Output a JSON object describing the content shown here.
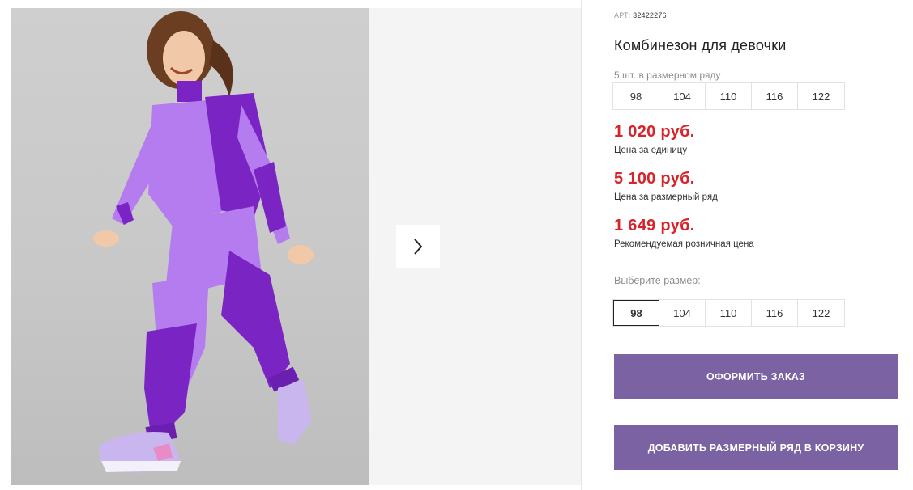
{
  "gallery": {
    "photo_alt": "",
    "next_icon": "chevron-right-icon"
  },
  "product": {
    "art_label": "АРТ:",
    "art_number": "32422276",
    "title": "Комбинезон для девочки",
    "pack_note": "5 шт. в размерном ряду",
    "pack_sizes": [
      "98",
      "104",
      "110",
      "116",
      "122"
    ],
    "prices": [
      {
        "value": "1 020 руб.",
        "label": "Цена за единицу"
      },
      {
        "value": "5 100 руб.",
        "label": "Цена за размерный ряд"
      },
      {
        "value": "1 649 руб.",
        "label": "Рекомендуемая розничная цена"
      }
    ],
    "choose_label": "Выберите размер:",
    "sizes": [
      "98",
      "104",
      "110",
      "116",
      "122"
    ],
    "selected_size": "98"
  },
  "buttons": {
    "order": "Оформить заказ",
    "add_to_cart": "Добавить размерный ряд в корзину"
  },
  "colors": {
    "price": "#d8232a",
    "button": "#7a62a3",
    "suit_light": "#b57cf0",
    "suit_dark": "#7a24c4"
  }
}
